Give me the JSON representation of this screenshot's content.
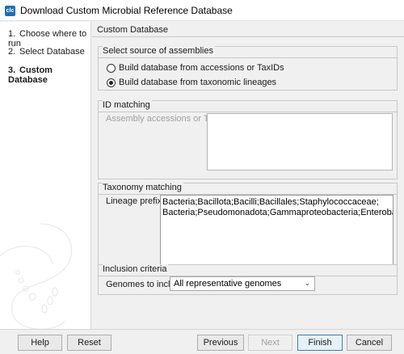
{
  "window": {
    "title": "Download Custom Microbial Reference Database",
    "app_icon_text": "clc"
  },
  "steps": [
    {
      "num": "1.",
      "label": "Choose where to run"
    },
    {
      "num": "2.",
      "label": "Select Database"
    },
    {
      "num": "3.",
      "label": "Custom Database"
    }
  ],
  "page": {
    "section_title": "Custom Database",
    "source_group": {
      "title": "Select source of assemblies",
      "options": [
        {
          "label": "Build database from accessions or TaxIDs",
          "selected": false
        },
        {
          "label": "Build database from taxonomic lineages",
          "selected": true
        }
      ]
    },
    "id_matching": {
      "title": "ID matching",
      "label": "Assembly accessions or TaxIDs",
      "value": ""
    },
    "taxonomy_matching": {
      "title": "Taxonomy matching",
      "label": "Lineage prefixes",
      "value": "Bacteria;Bacillota;Bacilli;Bacillales;Staphylococcaceae;\nBacteria;Pseudomonadota;Gammaproteobacteria;Enterobacterales"
    },
    "inclusion": {
      "title": "Inclusion criteria",
      "label": "Genomes to include",
      "selected": "All representative genomes"
    }
  },
  "buttons": {
    "help": "Help",
    "reset": "Reset",
    "previous": "Previous",
    "next": "Next",
    "finish": "Finish",
    "cancel": "Cancel"
  }
}
